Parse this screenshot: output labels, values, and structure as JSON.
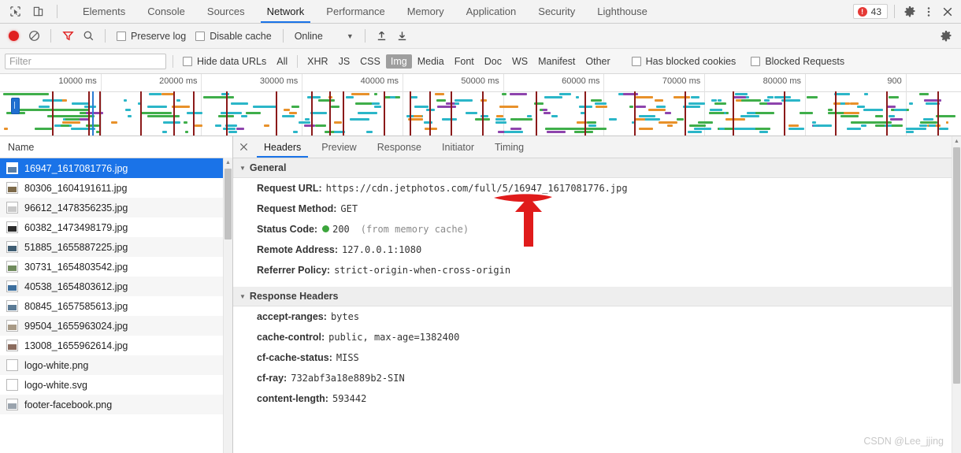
{
  "window": {
    "tabs": [
      {
        "label": "Elements",
        "active": false
      },
      {
        "label": "Console",
        "active": false
      },
      {
        "label": "Sources",
        "active": false
      },
      {
        "label": "Network",
        "active": true
      },
      {
        "label": "Performance",
        "active": false
      },
      {
        "label": "Memory",
        "active": false
      },
      {
        "label": "Application",
        "active": false
      },
      {
        "label": "Security",
        "active": false
      },
      {
        "label": "Lighthouse",
        "active": false
      }
    ],
    "error_count": "43",
    "icons": {
      "inspect": "inspect-element-icon",
      "device": "device-toolbar-icon",
      "settings": "gear-icon",
      "more": "more-options-icon",
      "close": "close-icon"
    },
    "accent_color": "#1a73e8",
    "error_color": "#e53935"
  },
  "controlbar": {
    "record_label": "record-button",
    "clear_label": "clear-button",
    "filter_toggle_label": "filter-toggle",
    "search_label": "search-button",
    "preserve_log": {
      "label": "Preserve log",
      "checked": false
    },
    "disable_cache": {
      "label": "Disable cache",
      "checked": false
    },
    "throttle": {
      "value": "Online"
    },
    "import_label": "import-har",
    "export_label": "export-har",
    "settings_label": "network-settings"
  },
  "filterbar": {
    "placeholder": "Filter",
    "value": "",
    "hide_data_urls": {
      "label": "Hide data URLs",
      "checked": false
    },
    "types": [
      {
        "label": "All",
        "active": false
      },
      {
        "label": "XHR",
        "active": false
      },
      {
        "label": "JS",
        "active": false
      },
      {
        "label": "CSS",
        "active": false
      },
      {
        "label": "Img",
        "active": true
      },
      {
        "label": "Media",
        "active": false
      },
      {
        "label": "Font",
        "active": false
      },
      {
        "label": "Doc",
        "active": false
      },
      {
        "label": "WS",
        "active": false
      },
      {
        "label": "Manifest",
        "active": false
      },
      {
        "label": "Other",
        "active": false
      }
    ],
    "has_blocked_cookies": {
      "label": "Has blocked cookies",
      "checked": false
    },
    "blocked_requests": {
      "label": "Blocked Requests",
      "checked": false
    }
  },
  "overview": {
    "ticks": [
      "10000 ms",
      "20000 ms",
      "30000 ms",
      "40000 ms",
      "50000 ms",
      "60000 ms",
      "70000 ms",
      "80000 ms",
      "900"
    ]
  },
  "requests": {
    "column_header": "Name",
    "items": [
      {
        "name": "16947_1617081776.jpg",
        "selected": true,
        "thumb": "#5b7fa6"
      },
      {
        "name": "80306_1604191611.jpg",
        "selected": false,
        "thumb": "#7d6a4a"
      },
      {
        "name": "96612_1478356235.jpg",
        "selected": false,
        "thumb": "#c9c9c9"
      },
      {
        "name": "60382_1473498179.jpg",
        "selected": false,
        "thumb": "#2b2b2b"
      },
      {
        "name": "51885_1655887225.jpg",
        "selected": false,
        "thumb": "#3e5c72"
      },
      {
        "name": "30731_1654803542.jpg",
        "selected": false,
        "thumb": "#6f8a5c"
      },
      {
        "name": "40538_1654803612.jpg",
        "selected": false,
        "thumb": "#3d6f9e"
      },
      {
        "name": "80845_1657585613.jpg",
        "selected": false,
        "thumb": "#5a7a95"
      },
      {
        "name": "99504_1655963024.jpg",
        "selected": false,
        "thumb": "#a89a86"
      },
      {
        "name": "13008_1655962614.jpg",
        "selected": false,
        "thumb": "#8a6b5d"
      },
      {
        "name": "logo-white.png",
        "selected": false,
        "thumb": "#ffffff"
      },
      {
        "name": "logo-white.svg",
        "selected": false,
        "thumb": "#ffffff"
      },
      {
        "name": "footer-facebook.png",
        "selected": false,
        "thumb": "#9aa3ad"
      }
    ]
  },
  "details": {
    "tabs": [
      {
        "label": "Headers",
        "active": true
      },
      {
        "label": "Preview",
        "active": false
      },
      {
        "label": "Response",
        "active": false
      },
      {
        "label": "Initiator",
        "active": false
      },
      {
        "label": "Timing",
        "active": false
      }
    ],
    "general": {
      "title": "General",
      "rows": [
        {
          "key": "Request URL:",
          "value": "https://cdn.jetphotos.com/full/5/16947_1617081776.jpg"
        },
        {
          "key": "Request Method:",
          "value": "GET"
        },
        {
          "key": "Status Code:",
          "value": "200",
          "note": "(from memory cache)",
          "status_ok": true
        },
        {
          "key": "Remote Address:",
          "value": "127.0.0.1:1080"
        },
        {
          "key": "Referrer Policy:",
          "value": "strict-origin-when-cross-origin"
        }
      ]
    },
    "response_headers": {
      "title": "Response Headers",
      "rows": [
        {
          "key": "accept-ranges:",
          "value": "bytes"
        },
        {
          "key": "cache-control:",
          "value": "public, max-age=1382400"
        },
        {
          "key": "cf-cache-status:",
          "value": "MISS"
        },
        {
          "key": "cf-ray:",
          "value": "732abf3a18e889b2-SIN"
        },
        {
          "key": "content-length:",
          "value": "593442"
        }
      ]
    }
  },
  "annotation": {
    "name": "red-arrow-annotation",
    "color": "#e01b1b",
    "target": "/full/"
  },
  "watermark": "CSDN @Lee_jjing"
}
